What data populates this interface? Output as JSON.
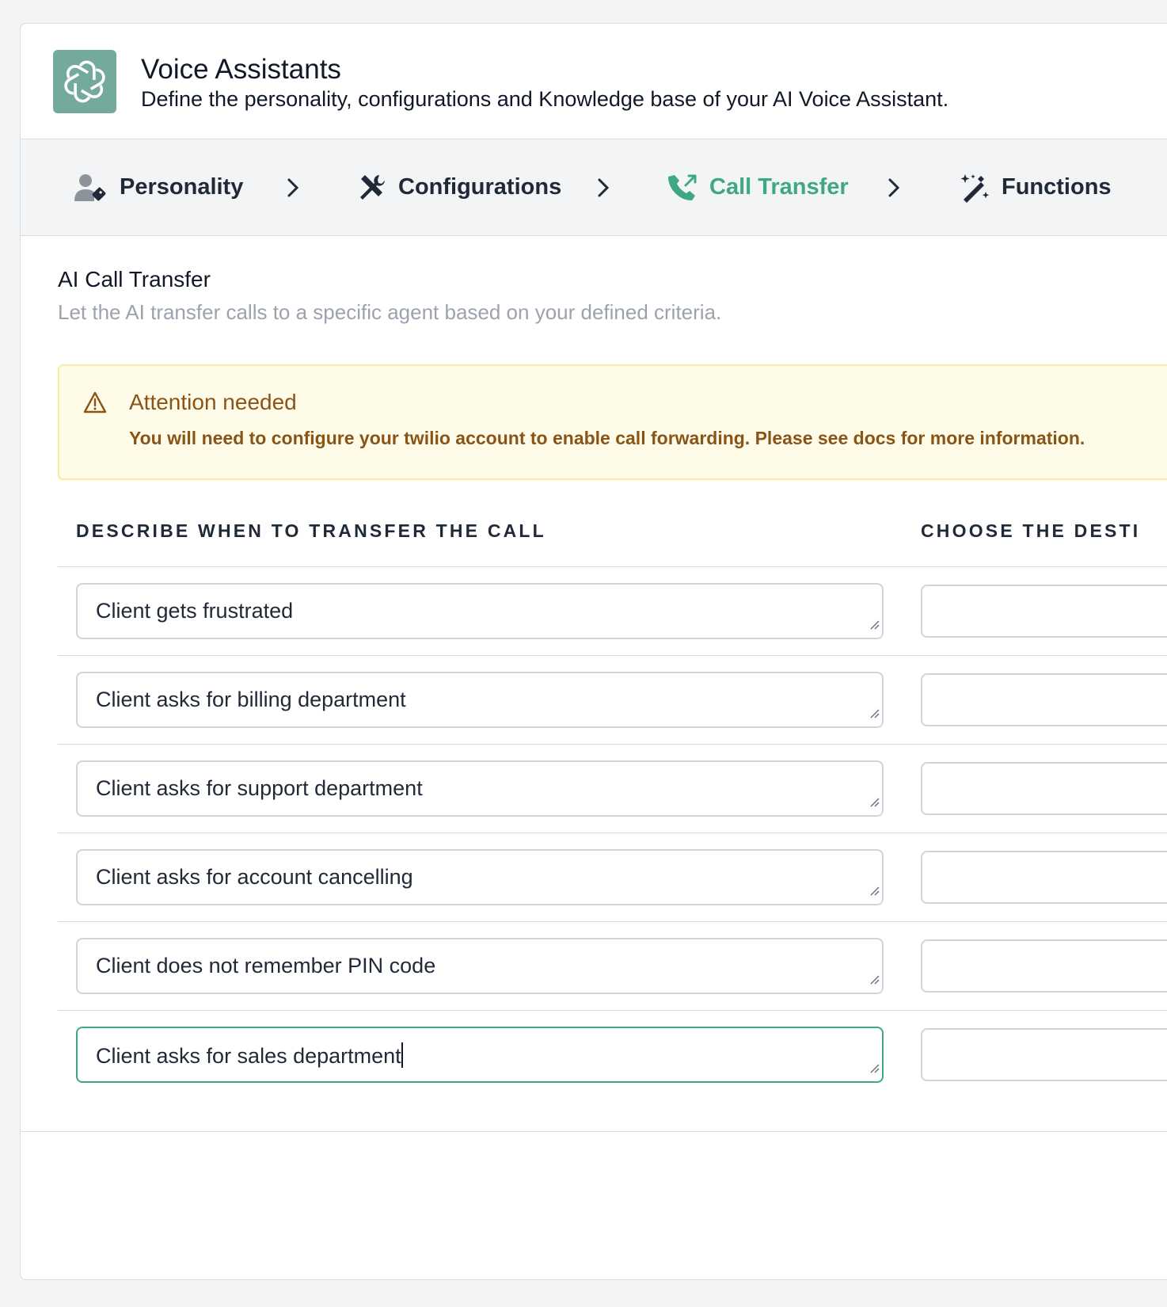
{
  "header": {
    "title": "Voice Assistants",
    "subtitle": "Define the personality, configurations and Knowledge base of your AI Voice Assistant.",
    "logo_icon": "openai-logo-icon"
  },
  "steps": [
    {
      "label": "Personality",
      "icon": "user-tag-icon",
      "active": false
    },
    {
      "label": "Configurations",
      "icon": "tools-icon",
      "active": false
    },
    {
      "label": "Call Transfer",
      "icon": "phone-forward-icon",
      "active": true
    },
    {
      "label": "Functions",
      "icon": "magic-wand-icon",
      "active": false
    }
  ],
  "section": {
    "title": "AI Call Transfer",
    "subtitle": "Let the AI transfer calls to a specific agent based on your defined criteria."
  },
  "alert": {
    "title": "Attention needed",
    "text": "You will need to configure your twilio account to enable call forwarding. Please see docs for more information."
  },
  "table": {
    "headers": [
      "DESCRIBE WHEN TO TRANSFER THE CALL",
      "CHOOSE THE DESTI"
    ],
    "rows": [
      {
        "condition": "Client gets frustrated",
        "destination": ""
      },
      {
        "condition": "Client asks for billing department",
        "destination": ""
      },
      {
        "condition": "Client asks for support department",
        "destination": ""
      },
      {
        "condition": "Client asks for account cancelling",
        "destination": ""
      },
      {
        "condition": "Client does not remember PIN code",
        "destination": ""
      },
      {
        "condition": "Client asks for sales department",
        "destination": "",
        "focused": true
      }
    ]
  },
  "colors": {
    "accent": "#3fa783",
    "logo_bg": "#74aa9c",
    "alert_bg": "#fefce8",
    "alert_text": "#8a5417"
  }
}
